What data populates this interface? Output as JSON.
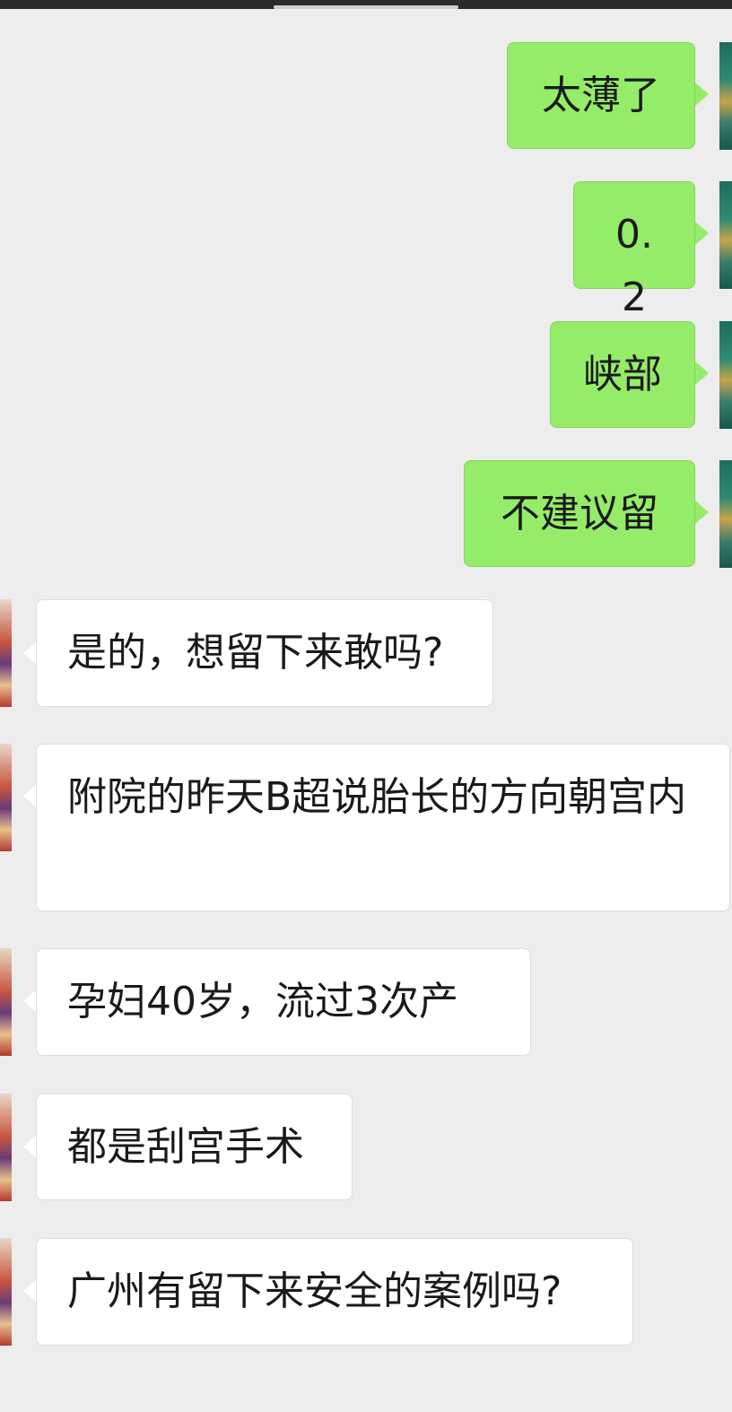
{
  "messages": [
    {
      "side": "out",
      "text": "太薄了"
    },
    {
      "side": "out",
      "text": "0.2"
    },
    {
      "side": "out",
      "text": "峡部"
    },
    {
      "side": "out",
      "text": "不建议留"
    },
    {
      "side": "in",
      "text": "是的，想留下来敢吗?"
    },
    {
      "side": "in",
      "text": "附院的昨天B超说胎长的方向朝宫内"
    },
    {
      "side": "in",
      "text": "孕妇40岁，流过3次产"
    },
    {
      "side": "in",
      "text": "都是刮宫手术"
    },
    {
      "side": "in",
      "text": "广州有留下来安全的案例吗?"
    }
  ],
  "colors": {
    "background": "#ededed",
    "outgoing_bubble": "#95ec69",
    "incoming_bubble": "#ffffff"
  }
}
